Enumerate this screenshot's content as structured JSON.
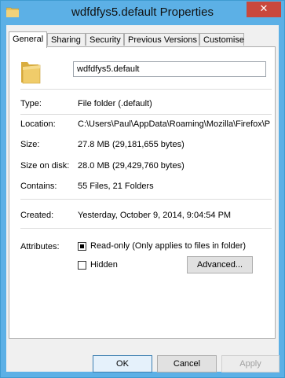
{
  "window": {
    "title": "wdfdfys5.default Properties",
    "close_glyph": "✕"
  },
  "tabs": [
    {
      "label": "General",
      "active": true
    },
    {
      "label": "Sharing",
      "active": false
    },
    {
      "label": "Security",
      "active": false
    },
    {
      "label": "Previous Versions",
      "active": false
    },
    {
      "label": "Customise",
      "active": false
    }
  ],
  "general": {
    "name_value": "wdfdfys5.default",
    "icon": "folder-icon",
    "type_label": "Type:",
    "type_value": "File folder (.default)",
    "location_label": "Location:",
    "location_value": "C:\\Users\\Paul\\AppData\\Roaming\\Mozilla\\Firefox\\P",
    "size_label": "Size:",
    "size_value": "27.8 MB (29,181,655 bytes)",
    "size_on_disk_label": "Size on disk:",
    "size_on_disk_value": "28.0 MB (29,429,760 bytes)",
    "contains_label": "Contains:",
    "contains_value": "55 Files, 21 Folders",
    "created_label": "Created:",
    "created_value": "Yesterday, October 9, 2014, 9:04:54 PM",
    "attributes_label": "Attributes:",
    "readonly_label": "Read-only (Only applies to files in folder)",
    "readonly_state": "indeterminate",
    "hidden_label": "Hidden",
    "hidden_checked": false,
    "advanced_label": "Advanced..."
  },
  "buttons": {
    "ok": "OK",
    "cancel": "Cancel",
    "apply": "Apply"
  },
  "colors": {
    "titlebar": "#5cb0e6",
    "close": "#c9483d",
    "folder": "#e8c15a"
  }
}
